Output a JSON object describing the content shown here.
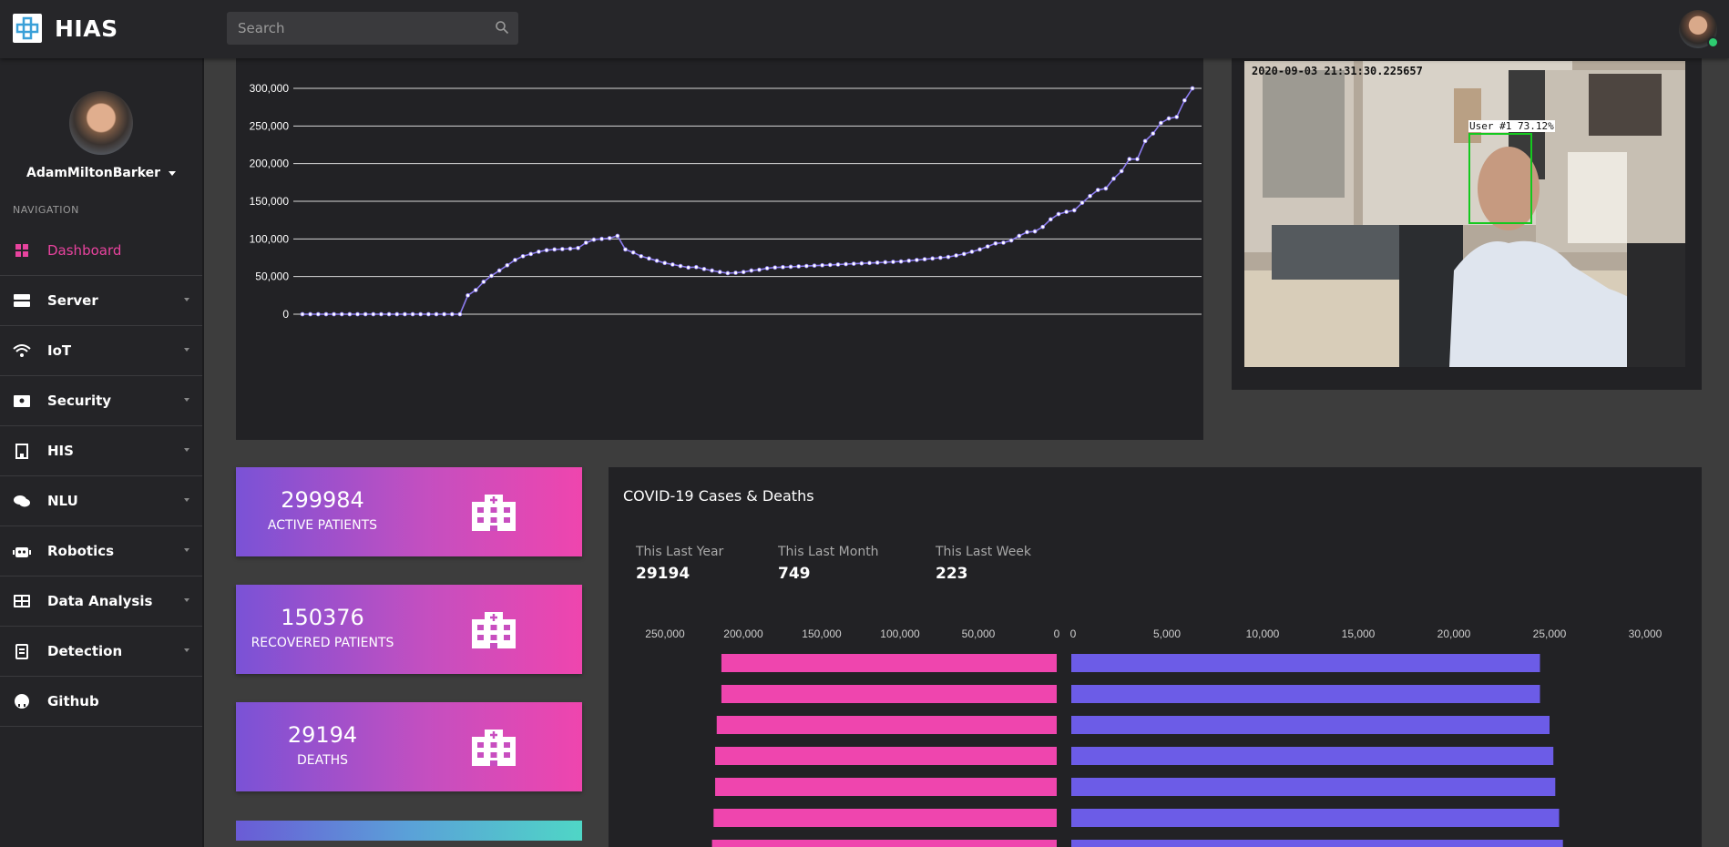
{
  "header": {
    "brand": "HIAS",
    "search_placeholder": "Search"
  },
  "sidebar": {
    "user_name": "AdamMiltonBarker",
    "nav_heading": "NAVIGATION",
    "items": [
      {
        "label": "Dashboard",
        "icon": "dashboard-icon",
        "active": true,
        "caret": false
      },
      {
        "label": "Server",
        "icon": "server-icon",
        "caret": true
      },
      {
        "label": "IoT",
        "icon": "wifi-icon",
        "caret": true
      },
      {
        "label": "Security",
        "icon": "id-badge-icon",
        "caret": true
      },
      {
        "label": "HIS",
        "icon": "hospital-building-icon",
        "caret": true
      },
      {
        "label": "NLU",
        "icon": "chat-icon",
        "caret": true
      },
      {
        "label": "Robotics",
        "icon": "robot-icon",
        "caret": true
      },
      {
        "label": "Data Analysis",
        "icon": "table-icon",
        "caret": true
      },
      {
        "label": "Detection",
        "icon": "clipboard-icon",
        "caret": true
      },
      {
        "label": "Github",
        "icon": "github-icon",
        "caret": false
      }
    ]
  },
  "camera": {
    "timestamp": "2020-09-03 21:31:30.225657",
    "detection_label": "User #1 73.12%"
  },
  "stats": [
    {
      "value": "299984",
      "label": "ACTIVE PATIENTS"
    },
    {
      "value": "150376",
      "label": "RECOVERED PATIENTS"
    },
    {
      "value": "29194",
      "label": "DEATHS"
    }
  ],
  "covid": {
    "title": "COVID-19 Cases & Deaths",
    "periods": [
      {
        "label": "This Last Year",
        "value": "29194"
      },
      {
        "label": "This Last Month",
        "value": "749"
      },
      {
        "label": "This Last Week",
        "value": "223"
      }
    ]
  },
  "colors": {
    "accent_pink": "#ef45ae",
    "accent_purple": "#6c5ce7",
    "line_purple": "#8c7cf0",
    "active_nav": "#e8439e"
  },
  "chart_data": [
    {
      "type": "line",
      "y_ticks": [
        "300,000",
        "250,000",
        "200,000",
        "150,000",
        "100,000",
        "50,000",
        "0"
      ],
      "ylim": [
        0,
        300000
      ],
      "grid": true,
      "values": [
        0,
        0,
        0,
        0,
        0,
        0,
        0,
        0,
        0,
        0,
        0,
        0,
        0,
        0,
        0,
        0,
        0,
        0,
        0,
        0,
        0,
        25000,
        32000,
        43000,
        51000,
        58000,
        65000,
        72000,
        77000,
        80000,
        83000,
        85000,
        86000,
        86500,
        87000,
        88000,
        95000,
        99000,
        100000,
        101000,
        104000,
        86000,
        82000,
        77000,
        74000,
        71000,
        68000,
        66000,
        64000,
        62000,
        62500,
        60000,
        58000,
        56000,
        54500,
        55000,
        56000,
        58000,
        59000,
        61000,
        62000,
        62500,
        63000,
        63500,
        64000,
        64500,
        65000,
        65500,
        66000,
        66500,
        67000,
        67500,
        68000,
        68500,
        69000,
        69500,
        70000,
        71000,
        72000,
        73000,
        74000,
        75000,
        76000,
        78000,
        80000,
        83000,
        86000,
        90000,
        94000,
        95000,
        98000,
        104000,
        109000,
        110000,
        116000,
        126000,
        133000,
        136000,
        138000,
        148000,
        157000,
        165000,
        167000,
        180000,
        190000,
        206000,
        206000,
        230000,
        240000,
        254000,
        260000,
        262000,
        284000,
        300000
      ]
    },
    {
      "type": "bar",
      "orientation": "horizontal",
      "left_axis_ticks": [
        "250,000",
        "200,000",
        "150,000",
        "100,000",
        "50,000",
        "0"
      ],
      "right_axis_ticks": [
        "0",
        "5,000",
        "10,000",
        "15,000",
        "20,000",
        "25,000",
        "30,000"
      ],
      "series": [
        {
          "color": "#ef45ae",
          "values": [
            214000,
            214000,
            217000,
            218000,
            218000,
            219000,
            220000
          ]
        },
        {
          "color": "#6c5ce7",
          "values": [
            24500,
            24500,
            25000,
            25200,
            25300,
            25500,
            25700
          ]
        }
      ]
    }
  ]
}
